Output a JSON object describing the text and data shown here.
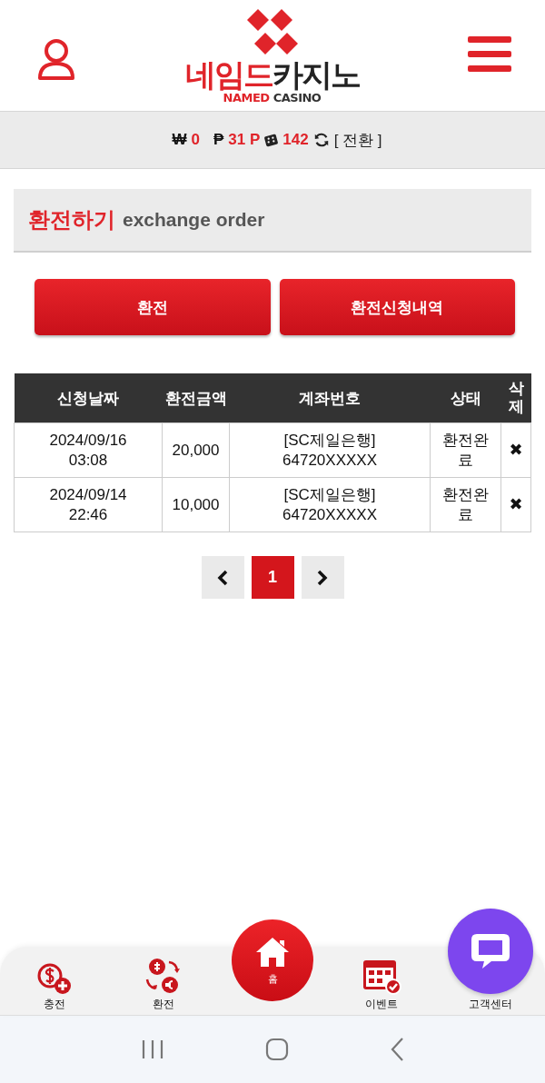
{
  "header": {
    "logo": {
      "title_red": "네임드",
      "title_dark": "카지노",
      "sub_red": "NAMED",
      "sub_dark": "CASINO"
    }
  },
  "balance": {
    "items": [
      {
        "symbol": "₩",
        "value": "0",
        "kind": "text"
      },
      {
        "symbol": "₱",
        "value": "31 P",
        "kind": "text"
      },
      {
        "value": "142",
        "kind": "dice"
      }
    ],
    "convert": "[ 전환 ]"
  },
  "section": {
    "title": "환전하기",
    "subtitle": "exchange order"
  },
  "buttons": [
    {
      "label": "환전"
    },
    {
      "label": "환전신청내역"
    }
  ],
  "table": {
    "columns": [
      "신청날짜",
      "환전금액",
      "계좌번호",
      "상태",
      "삭제"
    ],
    "rows": [
      {
        "date": "2024/09/16\n03:08",
        "amount": "20,000",
        "account": "[SC제일은행]\n64720XXXXX",
        "status": "환전완\n료",
        "delete": "✖"
      },
      {
        "date": "2024/09/14\n22:46",
        "amount": "10,000",
        "account": "[SC제일은행]\n64720XXXXX",
        "status": "환전완\n료",
        "delete": "✖"
      }
    ]
  },
  "pagination": {
    "pages": [
      {
        "label": "1",
        "selected": true
      }
    ]
  },
  "bottom_nav": [
    {
      "kind": "deposit",
      "label": "충전"
    },
    {
      "kind": "exchange",
      "label": "환전"
    },
    {
      "kind": "home",
      "label": "홈"
    },
    {
      "kind": "event",
      "label": "이벤트"
    },
    {
      "kind": "support",
      "label": "고객센터"
    }
  ]
}
